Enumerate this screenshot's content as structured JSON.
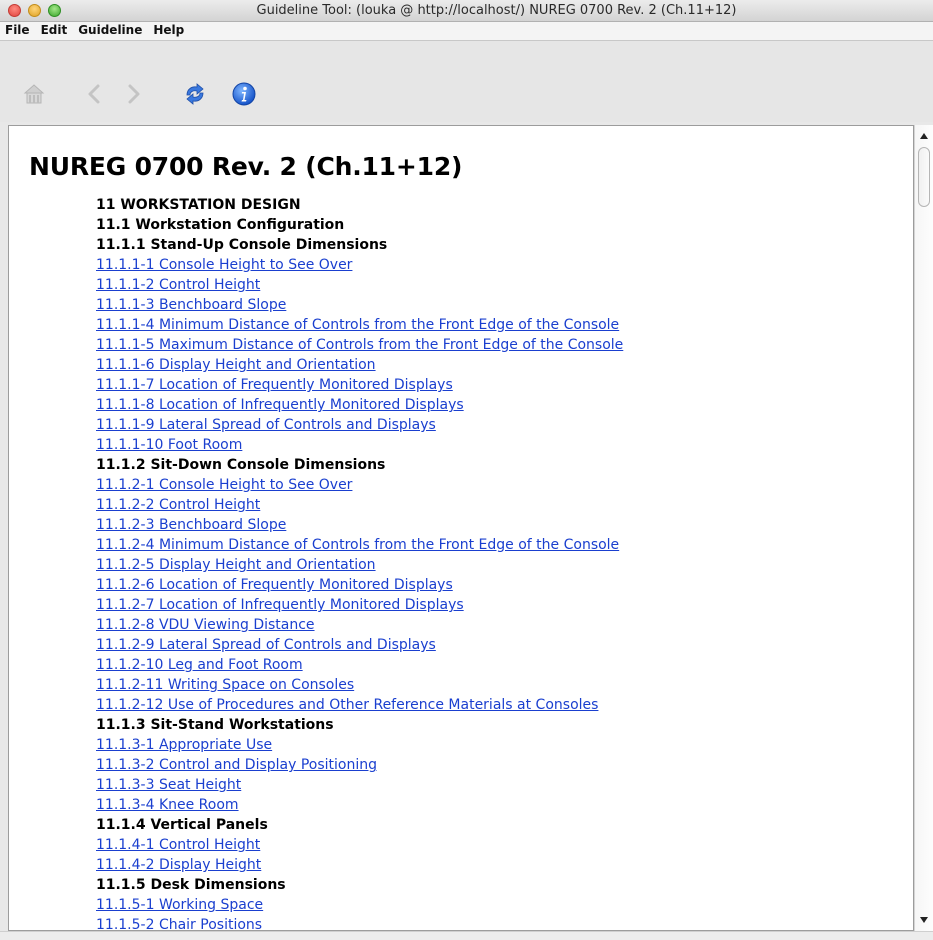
{
  "window": {
    "title": "Guideline Tool: (louka @ http://localhost/) NUREG 0700 Rev. 2 (Ch.11+12)"
  },
  "menu": {
    "file": "File",
    "edit": "Edit",
    "guideline": "Guideline",
    "help": "Help"
  },
  "toolbar": {
    "icons": [
      "home-icon",
      "back-arrow-icon",
      "forward-arrow-icon",
      "refresh-icon",
      "info-icon"
    ]
  },
  "document": {
    "title": "NUREG 0700 Rev. 2 (Ch.11+12)",
    "toc": [
      {
        "text": "11 WORKSTATION DESIGN",
        "kind": "heading"
      },
      {
        "text": "11.1 Workstation Configuration",
        "kind": "heading"
      },
      {
        "text": "11.1.1 Stand-Up Console Dimensions",
        "kind": "heading"
      },
      {
        "text": "11.1.1-1 Console Height to See Over",
        "kind": "link"
      },
      {
        "text": "11.1.1-2 Control Height",
        "kind": "link"
      },
      {
        "text": "11.1.1-3 Benchboard Slope",
        "kind": "link"
      },
      {
        "text": "11.1.1-4 Minimum Distance of Controls from the Front Edge of the Console",
        "kind": "link"
      },
      {
        "text": "11.1.1-5 Maximum Distance of Controls from the Front Edge of the Console",
        "kind": "link"
      },
      {
        "text": "11.1.1-6 Display Height and Orientation",
        "kind": "link"
      },
      {
        "text": "11.1.1-7 Location of Frequently Monitored Displays",
        "kind": "link"
      },
      {
        "text": "11.1.1-8 Location of Infrequently Monitored Displays",
        "kind": "link"
      },
      {
        "text": "11.1.1-9 Lateral Spread of Controls and Displays",
        "kind": "link"
      },
      {
        "text": "11.1.1-10 Foot Room",
        "kind": "link"
      },
      {
        "text": "11.1.2 Sit-Down Console Dimensions",
        "kind": "heading"
      },
      {
        "text": "11.1.2-1 Console Height to See Over",
        "kind": "link"
      },
      {
        "text": "11.1.2-2 Control Height",
        "kind": "link"
      },
      {
        "text": "11.1.2-3 Benchboard Slope",
        "kind": "link"
      },
      {
        "text": "11.1.2-4 Minimum Distance of Controls from the Front Edge of the Console",
        "kind": "link"
      },
      {
        "text": "11.1.2-5 Display Height and Orientation",
        "kind": "link"
      },
      {
        "text": "11.1.2-6 Location of Frequently Monitored Displays",
        "kind": "link"
      },
      {
        "text": "11.1.2-7 Location of Infrequently Monitored Displays",
        "kind": "link"
      },
      {
        "text": "11.1.2-8 VDU Viewing Distance",
        "kind": "link"
      },
      {
        "text": "11.1.2-9 Lateral Spread of Controls and Displays",
        "kind": "link"
      },
      {
        "text": "11.1.2-10 Leg and Foot Room",
        "kind": "link"
      },
      {
        "text": "11.1.2-11 Writing Space on Consoles",
        "kind": "link"
      },
      {
        "text": "11.1.2-12 Use of Procedures and Other Reference Materials at Consoles",
        "kind": "link"
      },
      {
        "text": "11.1.3 Sit-Stand Workstations",
        "kind": "heading"
      },
      {
        "text": "11.1.3-1 Appropriate Use",
        "kind": "link"
      },
      {
        "text": "11.1.3-2 Control and Display Positioning",
        "kind": "link"
      },
      {
        "text": "11.1.3-3 Seat Height",
        "kind": "link"
      },
      {
        "text": "11.1.3-4 Knee Room",
        "kind": "link"
      },
      {
        "text": "11.1.4 Vertical Panels",
        "kind": "heading"
      },
      {
        "text": "11.1.4-1 Control Height",
        "kind": "link"
      },
      {
        "text": "11.1.4-2 Display Height",
        "kind": "link"
      },
      {
        "text": "11.1.5 Desk Dimensions",
        "kind": "heading"
      },
      {
        "text": "11.1.5-1 Working Space",
        "kind": "link"
      },
      {
        "text": "11.1.5-2 Chair Positions",
        "kind": "link"
      }
    ]
  },
  "colors": {
    "link": "#1a3fcf",
    "info_icon": "#1f6fe0",
    "refresh_icon": "#2f6fd6"
  }
}
